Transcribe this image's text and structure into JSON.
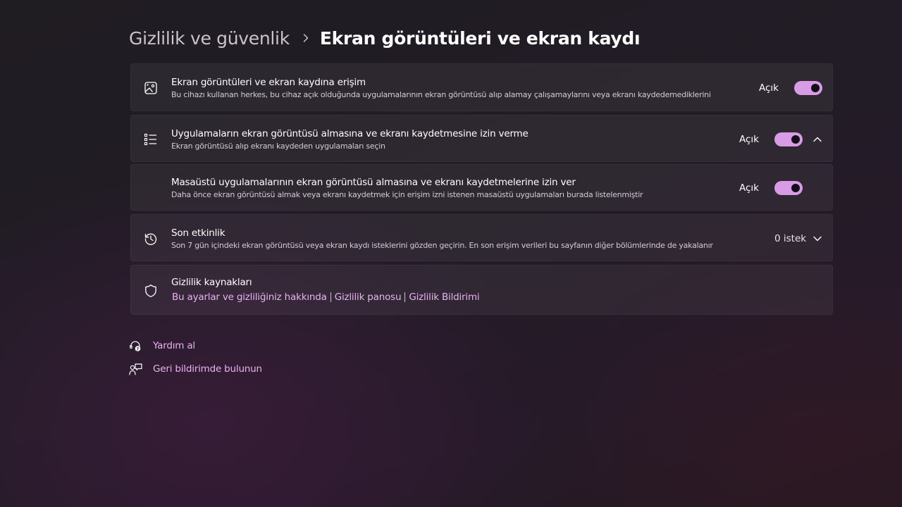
{
  "breadcrumb": {
    "parent": "Gizlilik ve güvenlik",
    "current": "Ekran görüntüleri ve ekran kaydı"
  },
  "settings": {
    "access": {
      "title": "Ekran görüntüleri ve ekran kaydına erişim",
      "description": "Bu cihazı kullanan herkes, bu cihaz açık olduğunda uygulamalarının ekran görüntüsü alıp alamay çalışamaylarını veya ekranı kaydedemediklerini",
      "state": "Açık",
      "icon": "screenshot-image-icon"
    },
    "apps": {
      "title": "Uygulamaların ekran görüntüsü almasına ve ekranı kaydetmesine izin verme",
      "description": "Ekran görüntüsü alıp ekranı kaydeden uygulamaları seçin",
      "state": "Açık",
      "icon": "list-icon"
    },
    "desktop_apps": {
      "title": "Masaüstü uygulamalarının ekran görüntüsü almasına ve ekranı kaydetmelerine izin ver",
      "description": "Daha önce ekran görüntüsü almak veya ekranı kaydetmek için erişim izni istenen masaüstü uygulamaları burada listelenmiştir",
      "state": "Açık"
    },
    "recent_activity": {
      "title": "Son etkinlik",
      "description": "Son 7 gün içindeki ekran görüntüsü veya ekran kaydı isteklerini gözden geçirin. En son erişim verileri bu sayfanın diğer bölümlerinde de yakalanır",
      "count": "0 istek",
      "icon": "history-icon"
    },
    "privacy_resources": {
      "title": "Gizlilik kaynakları",
      "links": [
        "Bu ayarlar ve gizliliğiniz hakkında",
        "Gizlilik panosu",
        "Gizlilik Bildirimi"
      ],
      "icon": "shield-icon"
    }
  },
  "footer": {
    "help": "Yardım al",
    "feedback": "Geri bildirimde bulunun"
  },
  "colors": {
    "accent": "#d99ae6",
    "link": "#e6b3ef"
  }
}
